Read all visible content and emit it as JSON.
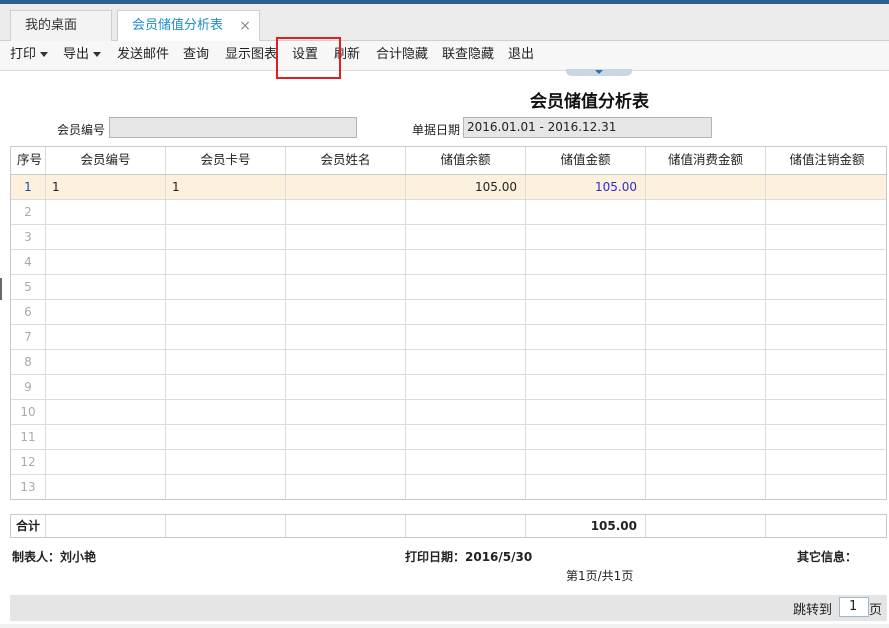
{
  "tabs": [
    {
      "label": "我的桌面"
    },
    {
      "label": "会员储值分析表",
      "close": "×"
    }
  ],
  "toolbar": {
    "print": "打印",
    "export": "导出",
    "send_email": "发送邮件",
    "query": "查询",
    "show_chart": "显示图表",
    "settings": "设置",
    "refresh": "刷新",
    "total_hide": "合计隐藏",
    "linked_hide": "联查隐藏",
    "exit": "退出"
  },
  "report": {
    "title": "会员储值分析表",
    "member_no_label": "会员编号",
    "member_no_value": "",
    "date_label": "单据日期",
    "date_value": "2016.01.01 - 2016.12.31"
  },
  "table": {
    "columns": [
      "序号",
      "会员编号",
      "会员卡号",
      "会员姓名",
      "储值余额",
      "储值金额",
      "储值消费金额",
      "储值注销金额"
    ],
    "rows": [
      [
        "1",
        "1",
        "1",
        "",
        "105.00",
        "105.00",
        "",
        ""
      ],
      [
        "2",
        "",
        "",
        "",
        "",
        "",
        "",
        ""
      ],
      [
        "3",
        "",
        "",
        "",
        "",
        "",
        "",
        ""
      ],
      [
        "4",
        "",
        "",
        "",
        "",
        "",
        "",
        ""
      ],
      [
        "5",
        "",
        "",
        "",
        "",
        "",
        "",
        ""
      ],
      [
        "6",
        "",
        "",
        "",
        "",
        "",
        "",
        ""
      ],
      [
        "7",
        "",
        "",
        "",
        "",
        "",
        "",
        ""
      ],
      [
        "8",
        "",
        "",
        "",
        "",
        "",
        "",
        ""
      ],
      [
        "9",
        "",
        "",
        "",
        "",
        "",
        "",
        ""
      ],
      [
        "10",
        "",
        "",
        "",
        "",
        "",
        "",
        ""
      ],
      [
        "11",
        "",
        "",
        "",
        "",
        "",
        "",
        ""
      ],
      [
        "12",
        "",
        "",
        "",
        "",
        "",
        "",
        ""
      ],
      [
        "13",
        "",
        "",
        "",
        "",
        "",
        "",
        ""
      ]
    ],
    "summary": [
      "合计",
      "",
      "",
      "",
      "",
      "105.00",
      "",
      ""
    ]
  },
  "footer": {
    "maker": "制表人：刘小艳",
    "print_date": "打印日期：2016/5/30",
    "other_info": "其它信息：",
    "page_info": "第1页/共1页"
  },
  "pager": {
    "jump_label": "跳转到",
    "jump_value": "1",
    "page_unit": "页"
  }
}
